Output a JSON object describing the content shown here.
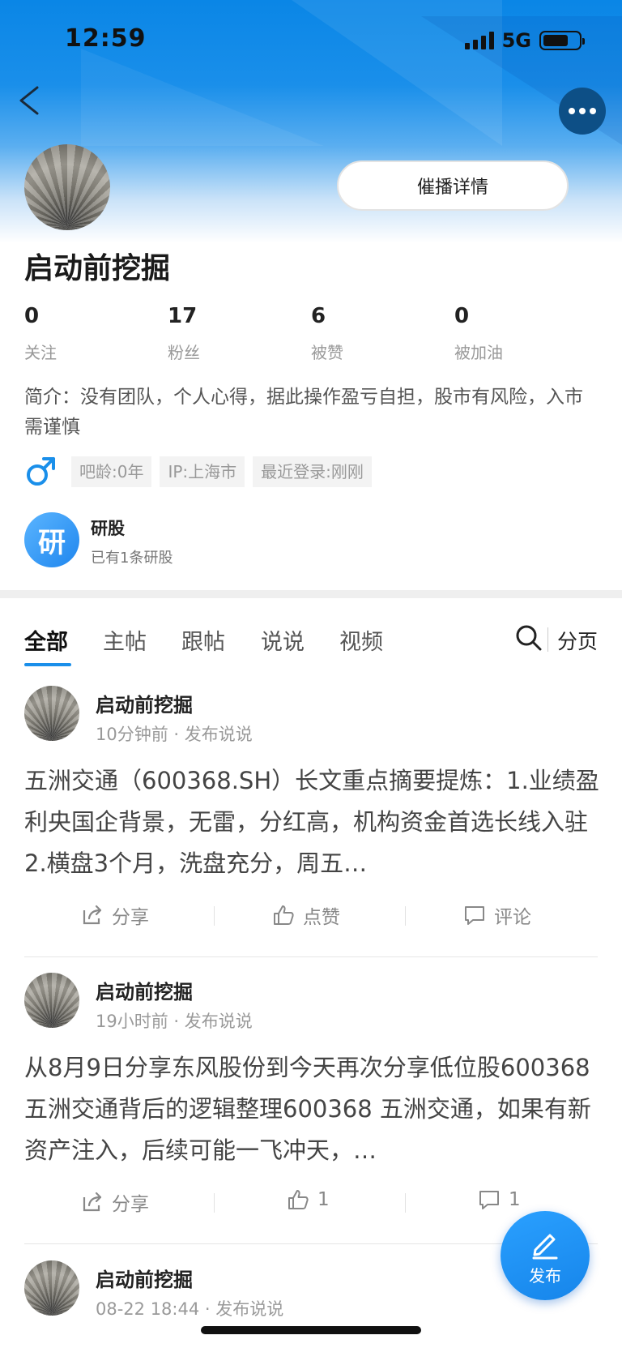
{
  "status_bar": {
    "time": "12:59",
    "network": "5G"
  },
  "profile": {
    "name": "启动前挖掘",
    "promote_button": "催播详情",
    "stats": [
      {
        "value": "0",
        "label": "关注"
      },
      {
        "value": "17",
        "label": "粉丝"
      },
      {
        "value": "6",
        "label": "被赞"
      },
      {
        "value": "0",
        "label": "被加油"
      }
    ],
    "bio": "简介：没有团队，个人心得，据此操作盈亏自担，股市有风险，入市需谨慎",
    "tags": [
      "吧龄:0年",
      "IP:上海市",
      "最近登录:刚刚"
    ],
    "research": {
      "icon_text": "研",
      "title": "研股",
      "subtitle": "已有1条研股"
    }
  },
  "tabs": {
    "items": [
      "全部",
      "主帖",
      "跟帖",
      "说说",
      "视频"
    ],
    "active": "全部",
    "paging": "分页"
  },
  "posts": [
    {
      "author": "启动前挖掘",
      "meta": "10分钟前 · 发布说说",
      "body": "五洲交通（600368.SH）长文重点摘要提炼：1.业绩盈利央国企背景，无雷，分红高，机构资金首选长线入驻 2.横盘3个月，洗盘充分，周五…",
      "share": "分享",
      "like": "点赞",
      "comment": "评论"
    },
    {
      "author": "启动前挖掘",
      "meta": "19小时前 · 发布说说",
      "body": "从8月9日分享东风股份到今天再次分享低位股600368五洲交通背后的逻辑整理600368 五洲交通，如果有新资产注入，后续可能一飞冲天，…",
      "share": "分享",
      "like": "1",
      "comment": "1"
    },
    {
      "author": "启动前挖掘",
      "meta": "08-22 18:44 · 发布说说"
    }
  ],
  "fab": {
    "label": "发布"
  },
  "colors": {
    "accent": "#1a8fea",
    "header_dark": "#0d4f86"
  }
}
